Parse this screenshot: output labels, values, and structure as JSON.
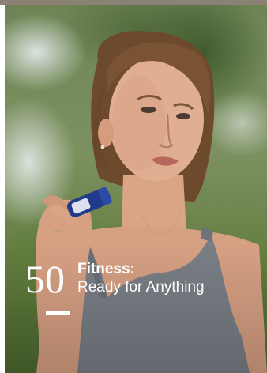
{
  "article": {
    "issue_number": "50",
    "title_line1": "Fitness:",
    "title_line2": "Ready for Anything"
  },
  "image": {
    "subject": "photo-woman-applying-roll-on",
    "accent_color": "#ffffff"
  }
}
